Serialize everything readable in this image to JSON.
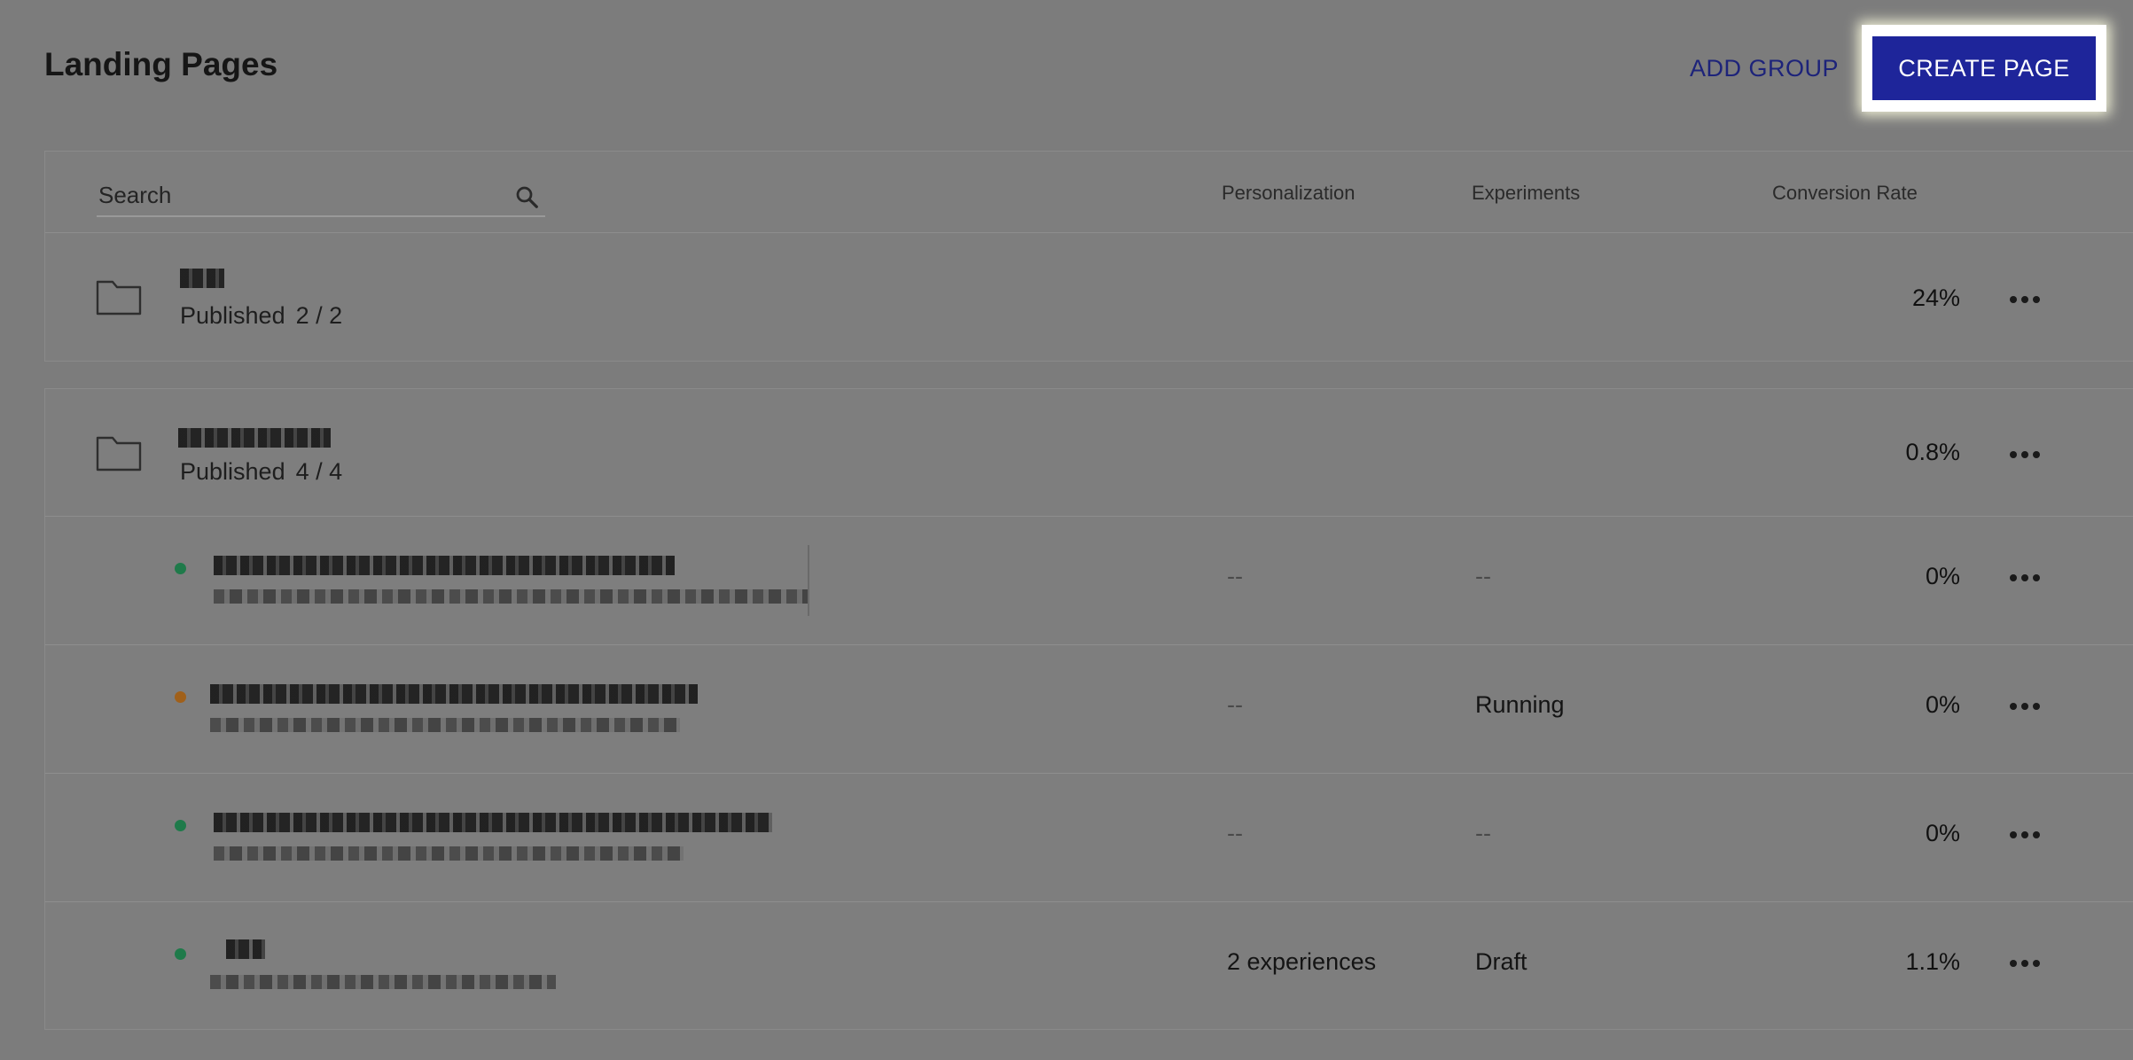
{
  "header": {
    "title": "Landing Pages",
    "add_group_label": "ADD GROUP",
    "create_page_label": "CREATE PAGE"
  },
  "table": {
    "search_placeholder": "Search",
    "columns": {
      "personalization": "Personalization",
      "experiments": "Experiments",
      "conversion_rate": "Conversion Rate"
    }
  },
  "groups": [
    {
      "published_label": "Published",
      "published_count": "2 / 2",
      "conversion_rate": "24%"
    },
    {
      "published_label": "Published",
      "published_count": "4 / 4",
      "conversion_rate": "0.8%"
    }
  ],
  "pages": [
    {
      "status_color": "#1f7a4a",
      "personalization": "--",
      "experiments": "--",
      "conversion_rate": "0%"
    },
    {
      "status_color": "#a0601a",
      "personalization": "--",
      "experiments": "Running",
      "conversion_rate": "0%"
    },
    {
      "status_color": "#1f7a4a",
      "personalization": "--",
      "experiments": "--",
      "conversion_rate": "0%"
    },
    {
      "status_color": "#1f7a4a",
      "personalization": "2 experiences",
      "experiments": "Draft",
      "conversion_rate": "1.1%"
    }
  ],
  "colors": {
    "primary_button": "#1e259a",
    "link": "#1d237a",
    "status_live": "#1f7a4a",
    "status_running": "#a0601a"
  }
}
